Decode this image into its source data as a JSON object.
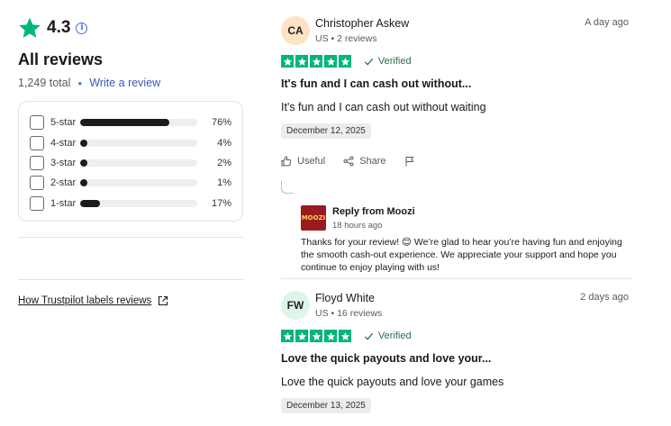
{
  "summary": {
    "rating": "4.3",
    "all_reviews_label": "All reviews",
    "total": "1,249 total",
    "write_review": "Write a review",
    "distribution": [
      {
        "label": "5-star",
        "percent": "76%",
        "fill": 0.76
      },
      {
        "label": "4-star",
        "percent": "4%",
        "fill": 0.04
      },
      {
        "label": "3-star",
        "percent": "2%",
        "fill": 0.02
      },
      {
        "label": "2-star",
        "percent": "1%",
        "fill": 0.01
      },
      {
        "label": "1-star",
        "percent": "17%",
        "fill": 0.17
      }
    ],
    "labels_link": "How Trustpilot labels reviews"
  },
  "reviews": [
    {
      "initials": "CA",
      "avatar_color": "#fde3c3",
      "name": "Christopher Askew",
      "meta": "US • 2 reviews",
      "relative_date": "A day ago",
      "verified": "Verified",
      "title": "It's fun and I can cash out without...",
      "body": "It's fun and I can cash out without waiting",
      "date": "December 12, 2025",
      "actions": {
        "useful": "Useful",
        "share": "Share"
      },
      "reply": {
        "logo_text": "MOOZI",
        "title": "Reply from Moozi",
        "time": "18 hours ago",
        "text": "Thanks for your review! 😊 We’re glad to hear you’re having fun and enjoying the smooth cash-out experience. We appreciate your support and hope you continue to enjoy playing with us!"
      }
    },
    {
      "initials": "FW",
      "avatar_color": "#dff5e6",
      "name": "Floyd White",
      "meta": "US • 16 reviews",
      "relative_date": "2 days ago",
      "verified": "Verified",
      "title": "Love the quick payouts and love your...",
      "body": "Love the quick payouts and love your games",
      "date": "December 13, 2025"
    }
  ],
  "colors": {
    "trustpilot_green": "#00b67a",
    "link_blue": "#3c57bc"
  }
}
